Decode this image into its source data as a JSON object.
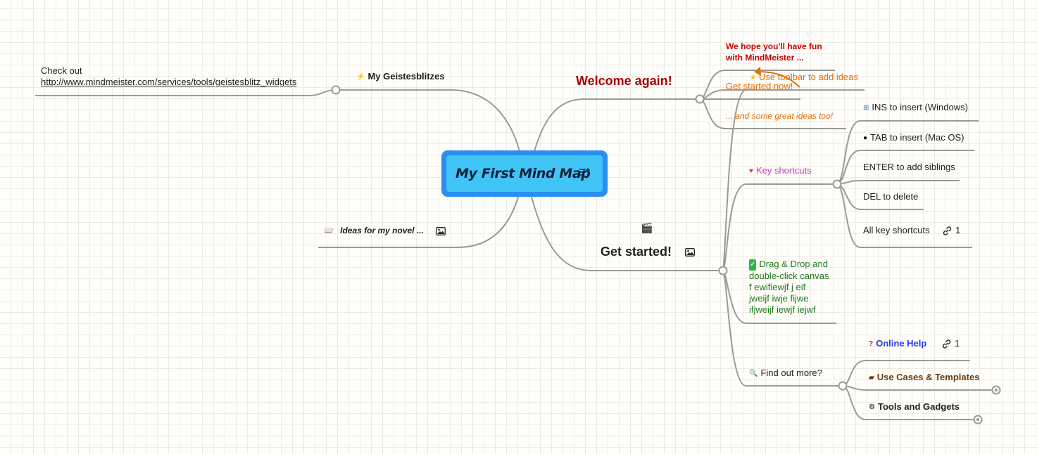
{
  "central": {
    "title": "My First Mind Map",
    "note_icon": "notes-icon"
  },
  "left": {
    "geistesblitzes": {
      "icon": "lightning-icon",
      "label": "My Geistesblitzes"
    },
    "check_out": {
      "line1": "Check out",
      "link": "http://www.mindmeister.com/services/tools/geistesblitz_widgets"
    },
    "novel": {
      "icon": "book-icon",
      "label": "Ideas for my novel ...",
      "image_icon": "image-icon"
    }
  },
  "welcome": {
    "label": "Welcome again!",
    "color": "#a50000",
    "children": {
      "fun_line1": "We hope you'll have fun",
      "fun_line2": "with MindMeister ...",
      "toolbar": {
        "icon": "star-icon",
        "label": "Use toolbar to add ideas"
      },
      "get_started_now": "Get started now!",
      "great_ideas": "... and some great ideas too!"
    }
  },
  "get_started": {
    "label": "Get started!",
    "icon": "clapperboard-icon",
    "image_icon": "image-icon",
    "key_shortcuts": {
      "icon": "heart-icon",
      "label": "Key shortcuts",
      "color": "#c83cc0",
      "items": [
        {
          "icon": "windows-icon",
          "label": "INS to insert (Windows)"
        },
        {
          "icon": "apple-icon",
          "label": "TAB to insert (Mac OS)"
        },
        {
          "icon": "",
          "label": "ENTER to add siblings"
        },
        {
          "icon": "",
          "label": "DEL to delete"
        },
        {
          "icon": "",
          "label": "All key shortcuts",
          "link_count": "1"
        }
      ]
    },
    "drag_drop": {
      "icon": "checkmark-icon",
      "lines": [
        "Drag & Drop and",
        "double-click canvas",
        "f ewifiewjf j eif",
        "jweijf iwje fijwe",
        "ifjweijf iewjf iejwf"
      ],
      "color": "#1e7a1e"
    },
    "find_out": {
      "icon": "magnifier-icon",
      "label": "Find out more?",
      "items": [
        {
          "icon": "question-icon",
          "label": "Online Help",
          "color": "#2a3be8",
          "link_count": "1"
        },
        {
          "icon": "briefcase-icon",
          "label": "Use Cases & Templates",
          "color": "#6b3a10"
        },
        {
          "icon": "gear-icon",
          "label": "Tools and Gadgets",
          "color": "#222222"
        }
      ]
    }
  },
  "colors": {
    "connector": "#9a9a9a",
    "orange": "#e0700a",
    "central_border": "#2b8ef0",
    "central_fill": "#40c3f5"
  }
}
